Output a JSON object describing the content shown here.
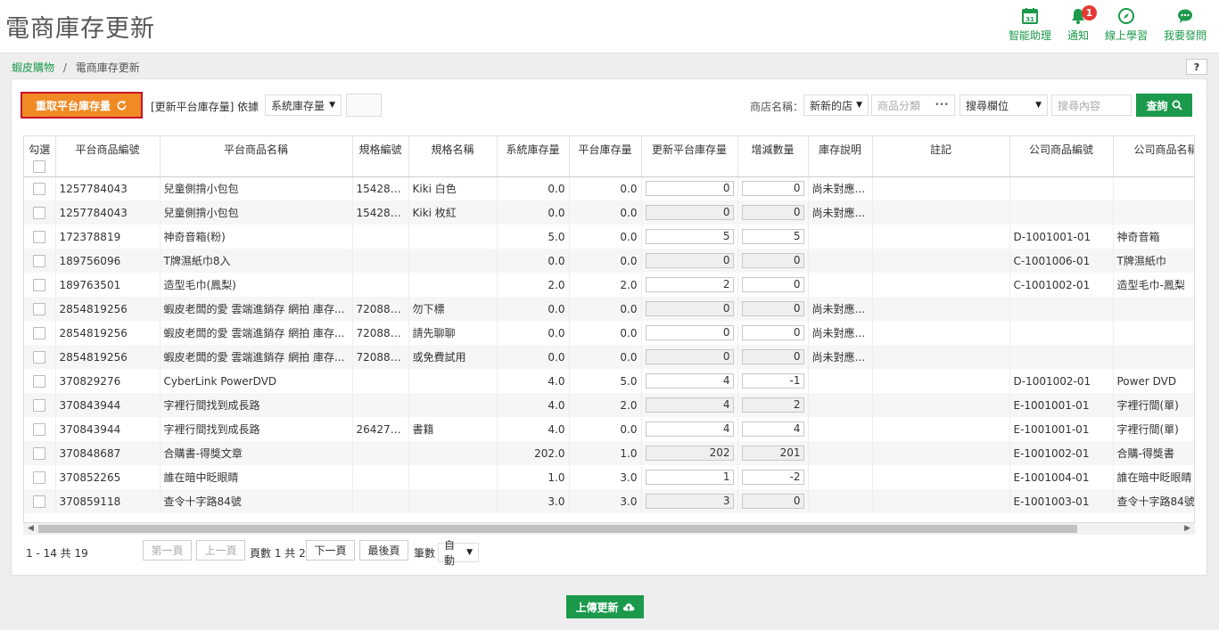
{
  "header": {
    "title": "電商庫存更新",
    "tools": [
      {
        "label": "智能助理",
        "icon": "calendar-icon"
      },
      {
        "label": "通知",
        "icon": "bell-icon",
        "badge": "1"
      },
      {
        "label": "線上學習",
        "icon": "compass-icon"
      },
      {
        "label": "我要發問",
        "icon": "chat-bubble-icon"
      }
    ]
  },
  "breadcrumb": {
    "root": "蝦皮購物",
    "separator": "/",
    "current": "電商庫存更新"
  },
  "help": {
    "label": "?"
  },
  "toolbar": {
    "refetch_label": "重取平台庫存量",
    "basis_label": "[更新平台庫存量] 依據",
    "basis_select": "系統庫存量",
    "store_label": "商店名稱：",
    "store_select": "新新的店",
    "category_placeholder": "商品分類",
    "category_dots": "•••",
    "search_field_select": "搜尋欄位",
    "search_placeholder": "搜尋內容",
    "query_label": "查詢"
  },
  "table": {
    "headers": {
      "check": "勾選",
      "platform_id": "平台商品編號",
      "platform_name": "平台商品名稱",
      "spec_id": "規格編號",
      "spec_name": "規格名稱",
      "system_stock": "系統庫存量",
      "platform_stock": "平台庫存量",
      "update_stock": "更新平台庫存量",
      "delta": "增減數量",
      "stock_note": "庫存說明",
      "remark": "註記",
      "company_id": "公司商品編號",
      "company_name": "公司商品名稱"
    },
    "rows": [
      {
        "pid": "1257784043",
        "pname": "兒童側揹小包包",
        "sid": "154289...",
        "sname": "Kiki 白色",
        "sys": "0.0",
        "plat": "0.0",
        "upd": "0",
        "upd_ro": false,
        "delta": "0",
        "delta_ro": false,
        "note": "尚未對應...",
        "cid": "",
        "cname": ""
      },
      {
        "pid": "1257784043",
        "pname": "兒童側揹小包包",
        "sid": "154289...",
        "sname": "Kiki 枚紅",
        "sys": "0.0",
        "plat": "0.0",
        "upd": "0",
        "upd_ro": true,
        "delta": "0",
        "delta_ro": true,
        "note": "尚未對應...",
        "cid": "",
        "cname": ""
      },
      {
        "pid": "172378819",
        "pname": "神奇音箱(粉)",
        "sid": "",
        "sname": "",
        "sys": "5.0",
        "plat": "0.0",
        "upd": "5",
        "upd_ro": false,
        "delta": "5",
        "delta_ro": false,
        "note": "",
        "cid": "D-1001001-01",
        "cname": "神奇音箱"
      },
      {
        "pid": "189756096",
        "pname": "T牌濕紙巾8入",
        "sid": "",
        "sname": "",
        "sys": "0.0",
        "plat": "0.0",
        "upd": "0",
        "upd_ro": true,
        "delta": "0",
        "delta_ro": true,
        "note": "",
        "cid": "C-1001006-01",
        "cname": "T牌濕紙巾"
      },
      {
        "pid": "189763501",
        "pname": "造型毛巾(鳳梨)",
        "sid": "",
        "sname": "",
        "sys": "2.0",
        "plat": "2.0",
        "upd": "2",
        "upd_ro": false,
        "delta": "0",
        "delta_ro": false,
        "note": "",
        "cid": "C-1001002-01",
        "cname": "造型毛巾-鳳梨"
      },
      {
        "pid": "2854819256",
        "pname": "蝦皮老闆的愛 雲端進銷存 網拍 庫存...",
        "sid": "720884...",
        "sname": "勿下標",
        "sys": "0.0",
        "plat": "0.0",
        "upd": "0",
        "upd_ro": true,
        "delta": "0",
        "delta_ro": true,
        "note": "尚未對應...",
        "cid": "",
        "cname": ""
      },
      {
        "pid": "2854819256",
        "pname": "蝦皮老闆的愛 雲端進銷存 網拍 庫存...",
        "sid": "720884...",
        "sname": "請先聊聊",
        "sys": "0.0",
        "plat": "0.0",
        "upd": "0",
        "upd_ro": false,
        "delta": "0",
        "delta_ro": false,
        "note": "尚未對應...",
        "cid": "",
        "cname": ""
      },
      {
        "pid": "2854819256",
        "pname": "蝦皮老闆的愛 雲端進銷存 網拍 庫存...",
        "sid": "720884...",
        "sname": "或免費試用",
        "sys": "0.0",
        "plat": "0.0",
        "upd": "0",
        "upd_ro": true,
        "delta": "0",
        "delta_ro": true,
        "note": "尚未對應...",
        "cid": "",
        "cname": ""
      },
      {
        "pid": "370829276",
        "pname": "CyberLink PowerDVD",
        "sid": "",
        "sname": "",
        "sys": "4.0",
        "plat": "5.0",
        "upd": "4",
        "upd_ro": false,
        "delta": "-1",
        "delta_ro": false,
        "note": "",
        "cid": "D-1001002-01",
        "cname": "Power DVD"
      },
      {
        "pid": "370843944",
        "pname": "字裡行間找到成長路",
        "sid": "",
        "sname": "",
        "sys": "4.0",
        "plat": "2.0",
        "upd": "4",
        "upd_ro": true,
        "delta": "2",
        "delta_ro": true,
        "note": "",
        "cid": "E-1001001-01",
        "cname": "字裡行間(單)"
      },
      {
        "pid": "370843944",
        "pname": "字裡行間找到成長路",
        "sid": "264276...",
        "sname": "書籍",
        "sys": "4.0",
        "plat": "0.0",
        "upd": "4",
        "upd_ro": false,
        "delta": "4",
        "delta_ro": false,
        "note": "",
        "cid": "E-1001001-01",
        "cname": "字裡行間(單)"
      },
      {
        "pid": "370848687",
        "pname": "合購書-得獎文章",
        "sid": "",
        "sname": "",
        "sys": "202.0",
        "plat": "1.0",
        "upd": "202",
        "upd_ro": true,
        "delta": "201",
        "delta_ro": true,
        "note": "",
        "cid": "E-1001002-01",
        "cname": "合購-得獎書"
      },
      {
        "pid": "370852265",
        "pname": "誰在暗中眨眼睛",
        "sid": "",
        "sname": "",
        "sys": "1.0",
        "plat": "3.0",
        "upd": "1",
        "upd_ro": false,
        "delta": "-2",
        "delta_ro": false,
        "note": "",
        "cid": "E-1001004-01",
        "cname": "誰在暗中眨眼睛"
      },
      {
        "pid": "370859118",
        "pname": "查令十字路84號",
        "sid": "",
        "sname": "",
        "sys": "3.0",
        "plat": "3.0",
        "upd": "3",
        "upd_ro": true,
        "delta": "0",
        "delta_ro": true,
        "note": "",
        "cid": "E-1001003-01",
        "cname": "查令十字路84號"
      }
    ]
  },
  "pager": {
    "count": "1 - 14 共 19",
    "first": "第一頁",
    "prev": "上一頁",
    "page_info": "頁數 1 共 2",
    "next": "下一頁",
    "last": "最後頁",
    "size_label": "筆數",
    "size_value": "自動"
  },
  "upload_label": "上傳更新",
  "colors": {
    "brand": "#1b9a4b",
    "accent": "#f08a24",
    "highlight": "#c8102e"
  }
}
